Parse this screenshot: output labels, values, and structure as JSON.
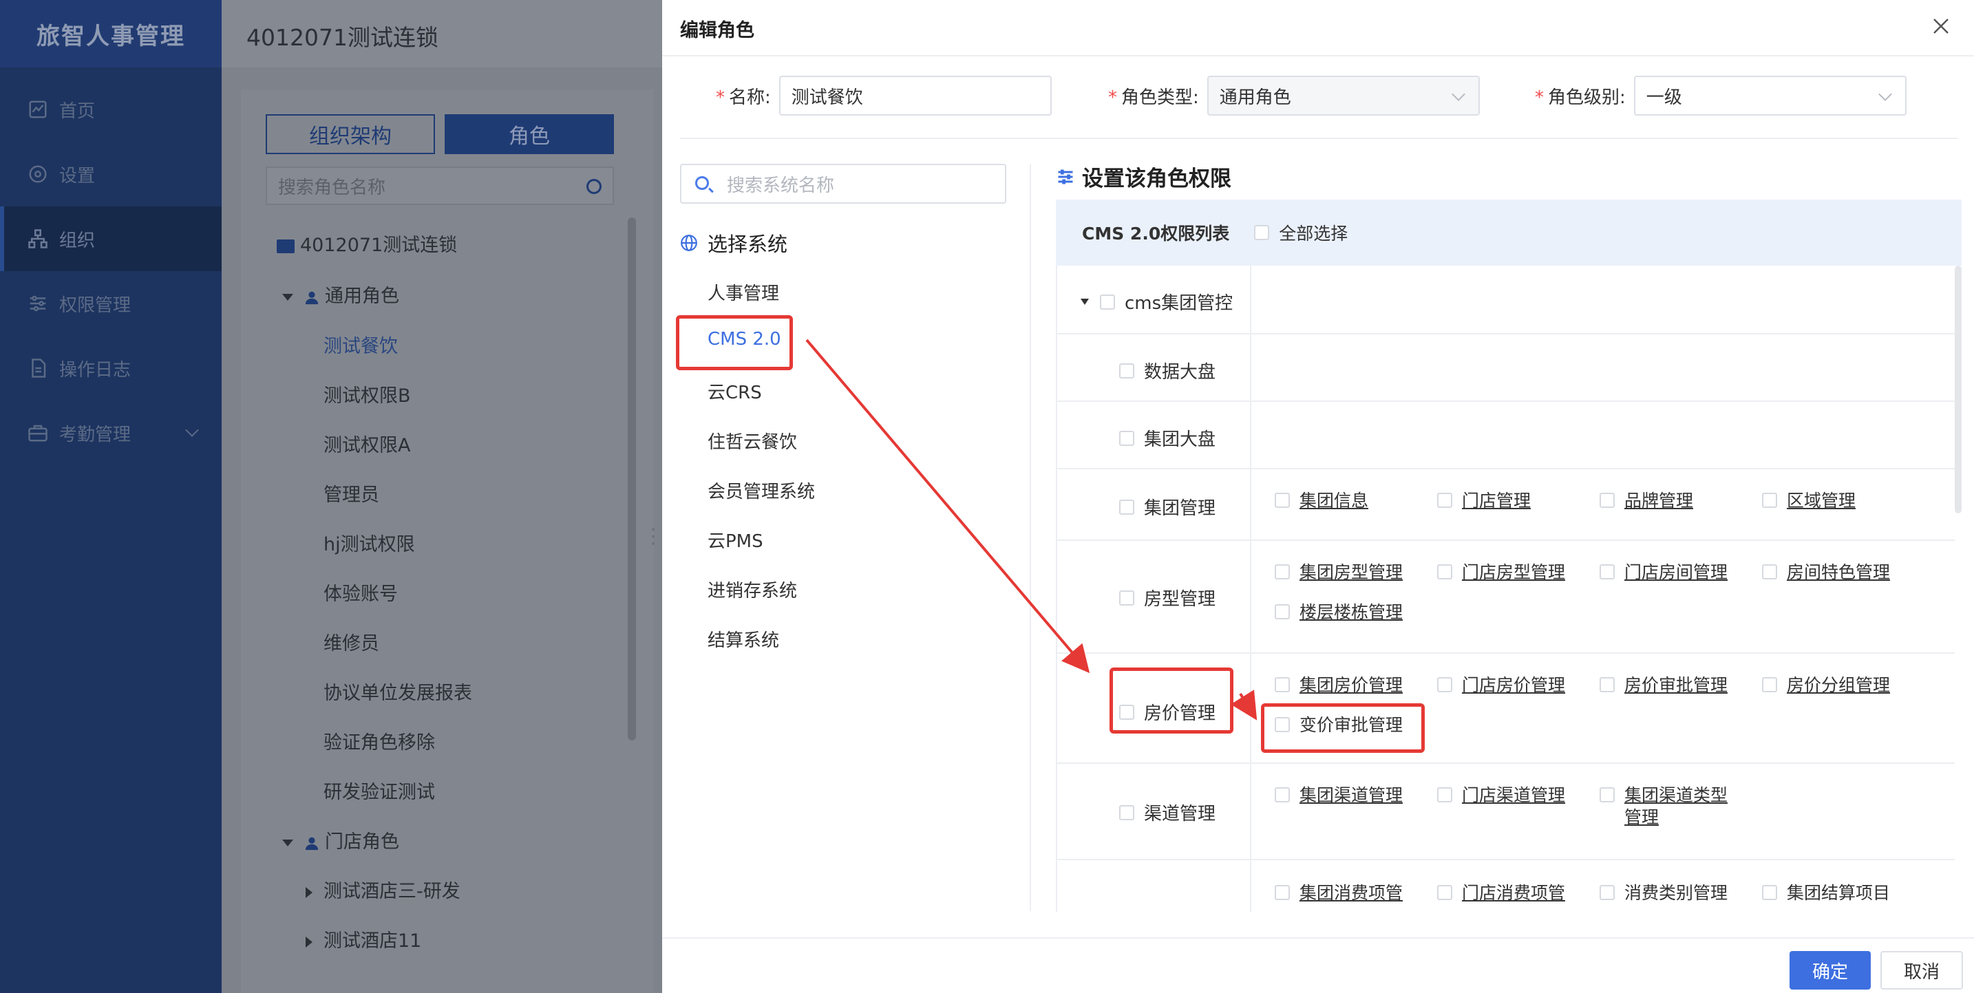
{
  "sidebar": {
    "brand": "旅智人事管理",
    "items": [
      {
        "label": "首页",
        "icon": "chart-icon"
      },
      {
        "label": "设置",
        "icon": "gear-icon"
      },
      {
        "label": "组织",
        "icon": "org-icon"
      },
      {
        "label": "权限管理",
        "icon": "sliders-icon"
      },
      {
        "label": "操作日志",
        "icon": "document-icon"
      },
      {
        "label": "考勤管理",
        "icon": "briefcase-icon"
      }
    ]
  },
  "topbar": {
    "title": "4012071测试连锁"
  },
  "org_panel": {
    "tab_org": "组织架构",
    "tab_role": "角色",
    "search_placeholder": "搜索角色名称",
    "root": "4012071测试连锁",
    "group_general": "通用角色",
    "general_roles": [
      "测试餐饮",
      "测试权限B",
      "测试权限A",
      "管理员",
      "hj测试权限",
      "体验账号",
      "维修员",
      "协议单位发展报表",
      "验证角色移除",
      "研发验证测试"
    ],
    "group_store": "门店角色",
    "store_roles": [
      "测试酒店三-研发",
      "测试酒店11"
    ]
  },
  "dialog": {
    "title": "编辑角色",
    "name_label": "名称:",
    "name_value": "测试餐饮",
    "type_label": "角色类型:",
    "type_value": "通用角色",
    "level_label": "角色级别:",
    "level_value": "一级",
    "required_mark": "*",
    "sys_search_placeholder": "搜索系统名称",
    "choose_sys": "选择系统",
    "systems": [
      "人事管理",
      "CMS 2.0",
      "云CRS",
      "住哲云餐饮",
      "会员管理系统",
      "云PMS",
      "进销存系统",
      "结算系统"
    ],
    "perm_title": "设置该角色权限",
    "perm_list_title": "CMS 2.0权限列表",
    "select_all": "全部选择",
    "perm_root": "cms集团管控",
    "rows": [
      {
        "label": "数据大盘",
        "subs": []
      },
      {
        "label": "集团大盘",
        "subs": []
      },
      {
        "label": "集团管理",
        "subs": [
          "集团信息",
          "门店管理",
          "品牌管理",
          "区域管理"
        ]
      },
      {
        "label": "房型管理",
        "subs": [
          "集团房型管理",
          "门店房型管理",
          "门店房间管理",
          "房间特色管理",
          "楼层楼栋管理"
        ]
      },
      {
        "label": "房价管理",
        "subs": [
          "集团房价管理",
          "门店房价管理",
          "房价审批管理",
          "房价分组管理",
          "变价审批管理"
        ]
      },
      {
        "label": "渠道管理",
        "subs": [
          "集团渠道管理",
          "门店渠道管理",
          "集团渠道类型管理"
        ]
      },
      {
        "label": "",
        "subs": [
          "集团消费项管",
          "门店消费项管",
          "消费类别管理",
          "集团结算项目"
        ]
      }
    ],
    "ok": "确定",
    "cancel": "取消"
  },
  "colors": {
    "primary": "#3d6fe0",
    "annotation": "#e53935",
    "sidebar_bg": "#1d3460"
  }
}
